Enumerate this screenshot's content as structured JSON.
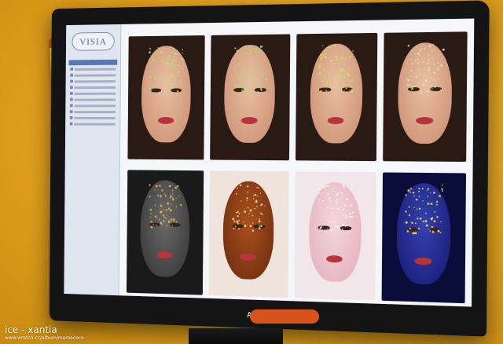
{
  "app": {
    "logo_text": "VISIA",
    "logo_subtitle": "",
    "monitor_brand": "ASUS",
    "badge_text": ""
  },
  "sidebar": {
    "header": "",
    "items": [
      "",
      "",
      "",
      "",
      "",
      "",
      "",
      "",
      "",
      ""
    ]
  },
  "tiles_top": [
    {
      "caption": "",
      "tone": "natural",
      "spot_color": "#b8e07a"
    },
    {
      "caption": "",
      "tone": "natural",
      "spot_color": "#9fe07a"
    },
    {
      "caption": "",
      "tone": "natural",
      "spot_color": "#c6e84a"
    },
    {
      "caption": "",
      "tone": "natural",
      "spot_color": "#d8e8b0"
    }
  ],
  "tiles_bottom": [
    {
      "caption": "",
      "tone": "gray",
      "spot_color": "#f0c040"
    },
    {
      "caption": "",
      "tone": "brown",
      "spot_color": "#f6e0a0"
    },
    {
      "caption": "",
      "tone": "pink",
      "spot_color": "#f4f4f4"
    },
    {
      "caption": "",
      "tone": "blue",
      "spot_color": "#f0e060"
    }
  ],
  "footer_text": "",
  "watermark": {
    "line1": "ice - xantia",
    "line2": "www.wretch.cc/album/mamecoco"
  },
  "colors": {
    "background": "#e3a21c",
    "accent": "#5b76b0",
    "badge": "#d8531c"
  }
}
